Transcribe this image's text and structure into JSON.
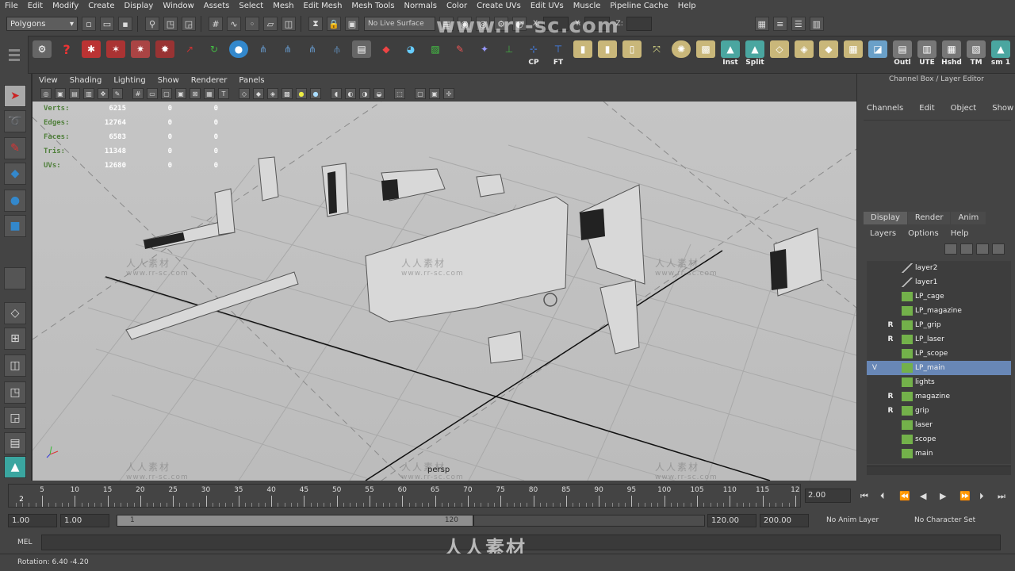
{
  "menu": [
    "File",
    "Edit",
    "Modify",
    "Create",
    "Display",
    "Window",
    "Assets",
    "Select",
    "Mesh",
    "Edit Mesh",
    "Mesh Tools",
    "Normals",
    "Color",
    "Create UVs",
    "Edit UVs",
    "Muscle",
    "Pipeline Cache",
    "Help"
  ],
  "status_line": {
    "mode": "Polygons",
    "live_surface": "No Live Surface",
    "x_label": "X:",
    "y_label": "Y:",
    "z_label": "Z:"
  },
  "shelf": {
    "labels": [
      "CP",
      "FT",
      "Inst",
      "Split",
      "Outl",
      "UTE",
      "Hshd",
      "TM",
      "sm 1"
    ]
  },
  "viewport": {
    "menu": [
      "View",
      "Shading",
      "Lighting",
      "Show",
      "Renderer",
      "Panels"
    ],
    "hud": [
      {
        "label": "Verts:",
        "v1": "6215",
        "v2": "0",
        "v3": "0"
      },
      {
        "label": "Edges:",
        "v1": "12764",
        "v2": "0",
        "v3": "0"
      },
      {
        "label": "Faces:",
        "v1": "6583",
        "v2": "0",
        "v3": "0"
      },
      {
        "label": "Tris:",
        "v1": "11348",
        "v2": "0",
        "v3": "0"
      },
      {
        "label": "UVs:",
        "v1": "12680",
        "v2": "0",
        "v3": "0"
      }
    ],
    "camera_label": "persp",
    "watermark_cn": "人人素材",
    "watermark_url": "www.rr-sc.com",
    "top_watermark": "www.rr-sc.com"
  },
  "channel_box": {
    "title": "Channel Box / Layer Editor",
    "menu": [
      "Channels",
      "Edit",
      "Object",
      "Show"
    ]
  },
  "layer_editor": {
    "tabs": [
      "Display",
      "Render",
      "Anim"
    ],
    "menu": [
      "Layers",
      "Options",
      "Help"
    ],
    "layers": [
      {
        "name": "layer2",
        "v": "",
        "r": "",
        "color": "none"
      },
      {
        "name": "layer1",
        "v": "",
        "r": "",
        "color": "none"
      },
      {
        "name": "LP_cage",
        "v": "",
        "r": "",
        "color": "#73b14a"
      },
      {
        "name": "LP_magazine",
        "v": "",
        "r": "",
        "color": "#73b14a"
      },
      {
        "name": "LP_grip",
        "v": "",
        "r": "R",
        "color": "#73b14a"
      },
      {
        "name": "LP_laser",
        "v": "",
        "r": "R",
        "color": "#73b14a"
      },
      {
        "name": "LP_scope",
        "v": "",
        "r": "",
        "color": "#73b14a"
      },
      {
        "name": "LP_main",
        "v": "V",
        "r": "",
        "color": "#73b14a",
        "selected": true
      },
      {
        "name": "lights",
        "v": "",
        "r": "",
        "color": "#73b14a"
      },
      {
        "name": "magazine",
        "v": "",
        "r": "R",
        "color": "#73b14a"
      },
      {
        "name": "grip",
        "v": "",
        "r": "R",
        "color": "#73b14a"
      },
      {
        "name": "laser",
        "v": "",
        "r": "",
        "color": "#73b14a"
      },
      {
        "name": "scope",
        "v": "",
        "r": "",
        "color": "#73b14a"
      },
      {
        "name": "main",
        "v": "",
        "r": "",
        "color": "#73b14a"
      }
    ]
  },
  "time_slider": {
    "ticks": [
      "5",
      "10",
      "15",
      "20",
      "25",
      "30",
      "35",
      "40",
      "45",
      "50",
      "55",
      "60",
      "65",
      "70",
      "75",
      "80",
      "85",
      "90",
      "95",
      "100",
      "105",
      "110",
      "115",
      "12"
    ],
    "current_marker": "2",
    "current_frame": "2.00"
  },
  "range_slider": {
    "start": "1.00",
    "range_start": "1.00",
    "bar_left": "1",
    "bar_right": "120",
    "range_end": "120.00",
    "end": "200.00",
    "anim_layer": "No Anim Layer",
    "char_set": "No Character Set"
  },
  "command_line": {
    "label": "MEL",
    "watermark": "人人素材"
  },
  "help_line": "Rotation: 6.40    -4.20"
}
